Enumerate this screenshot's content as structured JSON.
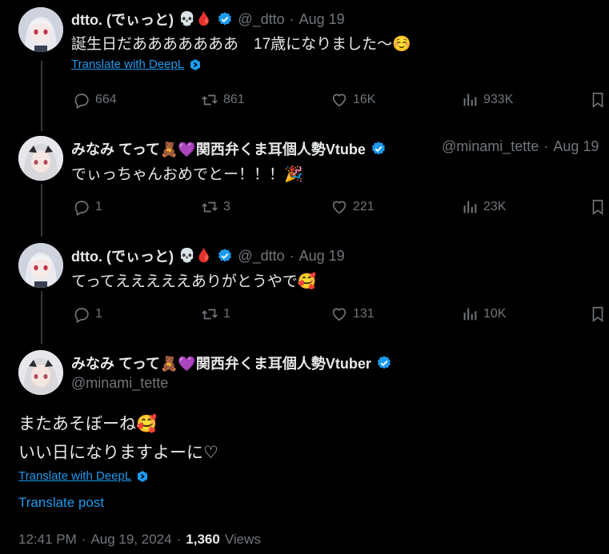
{
  "tweets": [
    {
      "name": "dtto. (でぃっと)",
      "emojis": "💀🩸",
      "handle": "@_dtto",
      "dot": "·",
      "date": "Aug 19",
      "text": "誕生日だあああああああ　17歳になりました〜☺️",
      "translate": "Translate with DeepL",
      "replies": "664",
      "retweets": "861",
      "likes": "16K",
      "views": "933K"
    },
    {
      "name": "みなみ てって🧸💜関西弁くま耳個人勢Vtube",
      "handle": "@minami_tette",
      "dot": "·",
      "date": "Aug 19",
      "text": "でぃっちゃんおめでとー！！！🎉",
      "replies": "1",
      "retweets": "3",
      "likes": "221",
      "views": "23K"
    },
    {
      "name": "dtto. (でぃっと)",
      "emojis": "💀🩸",
      "handle": "@_dtto",
      "dot": "·",
      "date": "Aug 19",
      "text": "てってえええええありがとうやで🥰",
      "replies": "1",
      "retweets": "1",
      "likes": "131",
      "views": "10K"
    }
  ],
  "main": {
    "name": "みなみ てって🧸💜関西弁くま耳個人勢Vtuber",
    "handle": "@minami_tette",
    "line1": "またあそぼーね🥰",
    "line2": "いい日になりますよーに♡",
    "translate": "Translate with DeepL",
    "translate_post": "Translate post",
    "time": "12:41 PM",
    "date": "Aug 19, 2024",
    "dot": "·",
    "views_count": "1,360",
    "views_label": "Views"
  },
  "colors": {
    "accent": "#1d9bf0",
    "muted": "#71767b",
    "text": "#e7e9ea",
    "line": "#333639"
  }
}
